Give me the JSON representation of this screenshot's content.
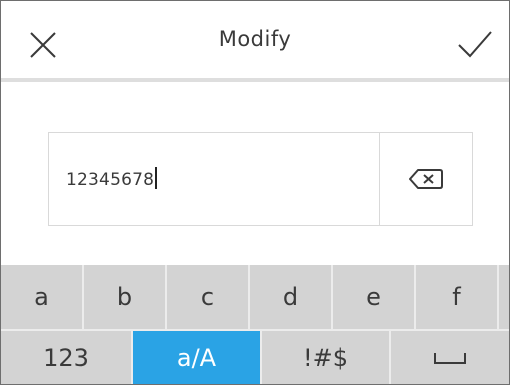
{
  "header": {
    "title": "Modify",
    "cancel_icon": "close-icon",
    "confirm_icon": "check-icon"
  },
  "input": {
    "value": "12345678",
    "backspace_icon": "backspace-icon"
  },
  "keyboard": {
    "letters": [
      "a",
      "b",
      "c",
      "d",
      "e",
      "f"
    ],
    "modes": [
      "123",
      "a/A",
      "!#$"
    ],
    "active_mode": "a/A",
    "space_icon": "space-icon"
  },
  "colors": {
    "accent": "#2aa3e5",
    "key_bg": "#d3d3d3",
    "text": "#3a3a3a"
  }
}
